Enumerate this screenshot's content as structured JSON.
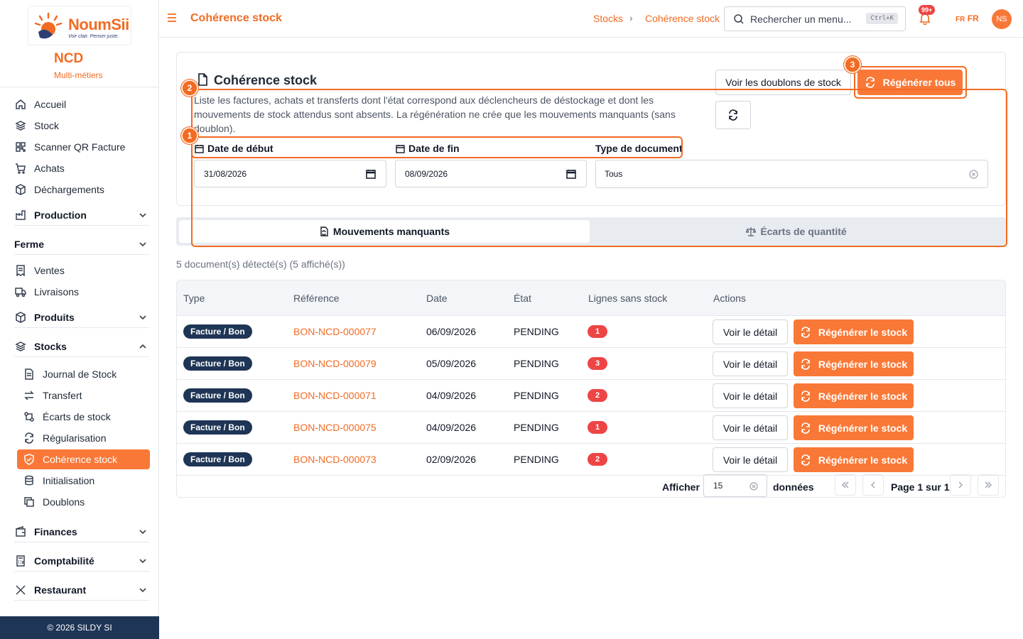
{
  "brand": {
    "logo_name": "NoumSii",
    "logo_tagline": "Voir clair. Penser juste.",
    "company": "NCD",
    "company_sub": "Multi-métiers",
    "footer": "© 2026 SILDY SI"
  },
  "sidebar": {
    "top_items": [
      {
        "label": "Accueil",
        "icon": "home-icon"
      },
      {
        "label": "Stock",
        "icon": "layers-icon"
      },
      {
        "label": "Scanner QR Facture",
        "icon": "qr-icon"
      },
      {
        "label": "Achats",
        "icon": "cart-icon"
      },
      {
        "label": "Déchargements",
        "icon": "box-icon"
      }
    ],
    "groups": {
      "production": "Production",
      "ferme": "Ferme",
      "produits": "Produits",
      "stocks": "Stocks",
      "finances": "Finances",
      "comptabilite": "Comptabilité",
      "restaurant": "Restaurant"
    },
    "ferme_items": [
      {
        "label": "Ventes"
      },
      {
        "label": "Livraisons"
      }
    ],
    "stock_sub": [
      {
        "label": "Journal de Stock"
      },
      {
        "label": "Transfert"
      },
      {
        "label": "Écarts de stock"
      },
      {
        "label": "Régularisation"
      },
      {
        "label": "Cohérence stock"
      },
      {
        "label": "Initialisation"
      },
      {
        "label": "Doublons"
      }
    ]
  },
  "header": {
    "title": "Cohérence stock",
    "breadcrumb": [
      "Stocks",
      "Cohérence stock"
    ],
    "search_placeholder": "Rechercher un menu...",
    "search_shortcut": "Ctrl+K",
    "notif_badge": "99+",
    "lang": "FR",
    "avatar": "NS"
  },
  "card": {
    "title": "Cohérence stock",
    "description": "Liste les factures, achats et transferts dont l'état correspond aux déclencheurs de déstockage et dont les mouvements de stock attendus sont absents. La régénération ne crée que les mouvements manquants (sans doublon).",
    "btn_duplicates": "Voir les doublons de stock",
    "btn_regen_all": "Régénérer tous",
    "filters": {
      "start_label": "Date de début",
      "start_value": "31/08/2026",
      "end_label": "Date de fin",
      "end_value": "08/09/2026",
      "type_label": "Type de document",
      "type_value": "Tous"
    }
  },
  "tabs": [
    {
      "label": "Mouvements manquants",
      "active": true
    },
    {
      "label": "Écarts de quantité",
      "active": false
    }
  ],
  "result_text": "5 document(s) détecté(s) (5 affiché(s))",
  "table": {
    "headers": [
      "Type",
      "Référence",
      "Date",
      "État",
      "Lignes sans stock",
      "Actions"
    ],
    "rows": [
      {
        "type": "Facture / Bon",
        "ref": "BON-NCD-000077",
        "date": "06/09/2026",
        "state": "PENDING",
        "count": "1"
      },
      {
        "type": "Facture / Bon",
        "ref": "BON-NCD-000079",
        "date": "05/09/2026",
        "state": "PENDING",
        "count": "3"
      },
      {
        "type": "Facture / Bon",
        "ref": "BON-NCD-000071",
        "date": "04/09/2026",
        "state": "PENDING",
        "count": "2"
      },
      {
        "type": "Facture / Bon",
        "ref": "BON-NCD-000075",
        "date": "04/09/2026",
        "state": "PENDING",
        "count": "1"
      },
      {
        "type": "Facture / Bon",
        "ref": "BON-NCD-000073",
        "date": "02/09/2026",
        "state": "PENDING",
        "count": "2"
      }
    ],
    "btn_detail": "Voir le détail",
    "btn_regen": "Régénérer le stock"
  },
  "pager": {
    "show_label": "Afficher",
    "page_size": "15",
    "data_label": "données",
    "page_info": "Page 1 sur 1"
  },
  "annotations": [
    "1",
    "2",
    "3"
  ],
  "colors": {
    "accent": "#f97837",
    "brand_dark": "#1f3556",
    "danger": "#ef4444"
  }
}
